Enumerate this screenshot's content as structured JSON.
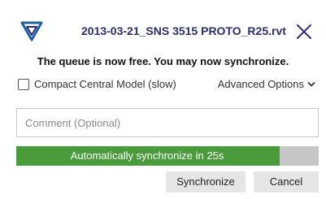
{
  "dialog": {
    "title": "2013-03-21_SNS 3515 PROTO_R25.rvt",
    "logo_icon": "revit-shield-logo-icon",
    "close_icon": "close-icon",
    "notice": "The queue is now free. You may now synchronize.",
    "compact_checkbox": {
      "label": "Compact Central Model (slow)",
      "checked": false
    },
    "advanced_options": {
      "label": "Advanced Options",
      "icon": "chevron-down-icon"
    },
    "comment": {
      "placeholder": "Comment (Optional)",
      "value": ""
    },
    "progress": {
      "text": "Automatically synchronize in 25s",
      "fraction": 0.87
    },
    "buttons": {
      "synchronize": "Synchronize",
      "cancel": "Cancel"
    }
  },
  "colors": {
    "title": "#2a2e6e",
    "progress_fill": "#4a9b3b",
    "progress_track": "#c6c6c6",
    "button_bg": "#e6e6e6"
  }
}
